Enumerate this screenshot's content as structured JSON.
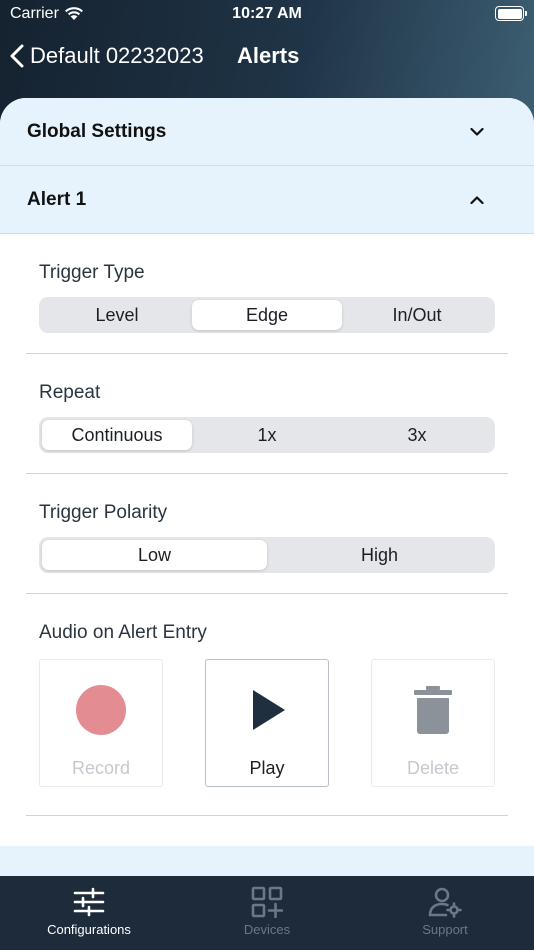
{
  "status_bar": {
    "carrier": "Carrier",
    "time": "10:27 AM"
  },
  "nav": {
    "back_label": "Default 02232023",
    "title": "Alerts"
  },
  "sections": {
    "global": {
      "title": "Global Settings",
      "expanded": false
    },
    "alert1": {
      "title": "Alert 1",
      "expanded": true
    }
  },
  "trigger_type": {
    "label": "Trigger Type",
    "options": [
      "Level",
      "Edge",
      "In/Out"
    ],
    "selected": "Edge"
  },
  "repeat": {
    "label": "Repeat",
    "options": [
      "Continuous",
      "1x",
      "3x"
    ],
    "selected": "Continuous"
  },
  "trigger_polarity": {
    "label": "Trigger Polarity",
    "options": [
      "Low",
      "High"
    ],
    "selected": "Low"
  },
  "audio": {
    "label": "Audio on Alert Entry",
    "record_label": "Record",
    "play_label": "Play",
    "delete_label": "Delete",
    "record_enabled": false,
    "play_enabled": true,
    "delete_enabled": false
  },
  "tabs": [
    {
      "label": "Configurations",
      "icon": "sliders-icon",
      "active": true
    },
    {
      "label": "Devices",
      "icon": "qr-grid-icon",
      "active": false
    },
    {
      "label": "Support",
      "icon": "user-gear-icon",
      "active": false
    }
  ],
  "colors": {
    "header_dark": "#152230",
    "section_bg": "#e6f3fc",
    "record_red": "#e38c92",
    "play_dark": "#1f2f40",
    "delete_gray": "#8c9299",
    "tab_bar_bg": "#1d2b3a",
    "tab_inactive": "#6b7885"
  }
}
